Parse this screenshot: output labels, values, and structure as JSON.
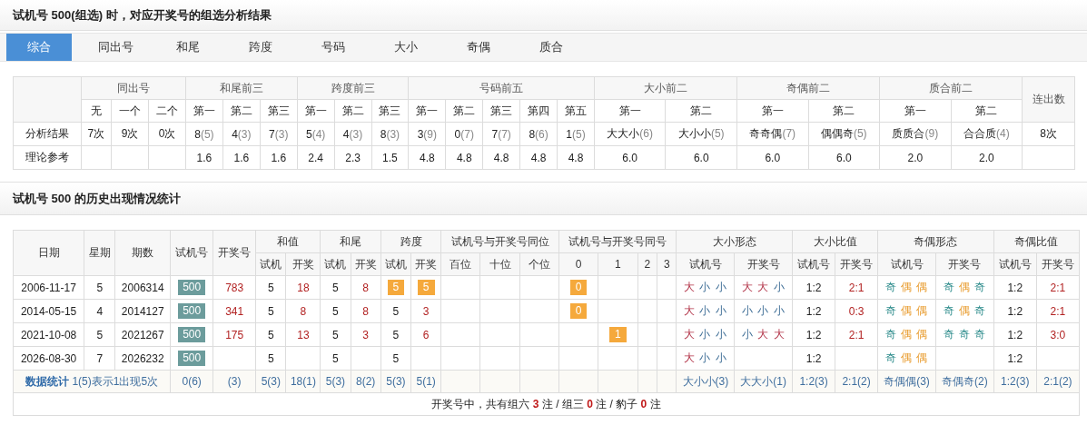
{
  "title": "试机号 500(组选) 时，对应开奖号的组选分析结果",
  "tabs": [
    {
      "label": "综合",
      "selected": true
    },
    {
      "label": "同出号",
      "selected": false
    },
    {
      "label": "和尾",
      "selected": false
    },
    {
      "label": "跨度",
      "selected": false
    },
    {
      "label": "号码",
      "selected": false
    },
    {
      "label": "大小",
      "selected": false
    },
    {
      "label": "奇偶",
      "selected": false
    },
    {
      "label": "质合",
      "selected": false
    }
  ],
  "analysis": {
    "groups": [
      {
        "label": "同出号",
        "sub": [
          "无",
          "一个",
          "二个"
        ]
      },
      {
        "label": "和尾前三",
        "sub": [
          "第一",
          "第二",
          "第三"
        ]
      },
      {
        "label": "跨度前三",
        "sub": [
          "第一",
          "第二",
          "第三"
        ]
      },
      {
        "label": "号码前五",
        "sub": [
          "第一",
          "第二",
          "第三",
          "第四",
          "第五"
        ]
      },
      {
        "label": "大小前二",
        "sub": [
          "第一",
          "第二"
        ]
      },
      {
        "label": "奇偶前二",
        "sub": [
          "第一",
          "第二"
        ]
      },
      {
        "label": "质合前二",
        "sub": [
          "第一",
          "第二"
        ]
      },
      {
        "label": "连出数"
      }
    ],
    "rows": [
      {
        "label": "分析结果",
        "cells": [
          {
            "text": "7次"
          },
          {
            "text": "9次"
          },
          {
            "text": "0次"
          },
          {
            "text": "8",
            "note": "(5)"
          },
          {
            "text": "4",
            "note": "(3)"
          },
          {
            "text": "7",
            "note": "(3)"
          },
          {
            "text": "5",
            "note": "(4)"
          },
          {
            "text": "4",
            "note": "(3)"
          },
          {
            "text": "8",
            "note": "(3)"
          },
          {
            "text": "3",
            "note": "(9)"
          },
          {
            "text": "0",
            "note": "(7)"
          },
          {
            "text": "7",
            "note": "(7)"
          },
          {
            "text": "8",
            "note": "(6)"
          },
          {
            "text": "1",
            "note": "(5)"
          },
          {
            "text": "大大小",
            "note": "(6)"
          },
          {
            "text": "大小小",
            "note": "(5)"
          },
          {
            "text": "奇奇偶",
            "note": "(7)"
          },
          {
            "text": "偶偶奇",
            "note": "(5)"
          },
          {
            "text": "质质合",
            "note": "(9)"
          },
          {
            "text": "合合质",
            "note": "(4)"
          },
          {
            "text": "8次"
          }
        ]
      },
      {
        "label": "理论参考",
        "cells": [
          null,
          null,
          null,
          {
            "text": "1.6"
          },
          {
            "text": "1.6"
          },
          {
            "text": "1.6"
          },
          {
            "text": "2.4"
          },
          {
            "text": "2.3"
          },
          {
            "text": "1.5"
          },
          {
            "text": "4.8"
          },
          {
            "text": "4.8"
          },
          {
            "text": "4.8"
          },
          {
            "text": "4.8"
          },
          {
            "text": "4.8"
          },
          {
            "text": "6.0"
          },
          {
            "text": "6.0"
          },
          {
            "text": "6.0"
          },
          {
            "text": "6.0"
          },
          {
            "text": "2.0"
          },
          {
            "text": "2.0"
          },
          null
        ]
      }
    ]
  },
  "history_title": "试机号 500 的历史出现情况统计",
  "history": {
    "groups": [
      {
        "label": "日期"
      },
      {
        "label": "星期"
      },
      {
        "label": "期数"
      },
      {
        "label": "试机号"
      },
      {
        "label": "开奖号"
      },
      {
        "label": "和值",
        "sub": [
          "试机",
          "开奖"
        ]
      },
      {
        "label": "和尾",
        "sub": [
          "试机",
          "开奖"
        ]
      },
      {
        "label": "跨度",
        "sub": [
          "试机",
          "开奖"
        ]
      },
      {
        "label": "试机号与开奖号同位",
        "sub": [
          "百位",
          "十位",
          "个位"
        ]
      },
      {
        "label": "试机号与开奖号同号",
        "sub": [
          "0",
          "1",
          "2",
          "3"
        ]
      },
      {
        "label": "大小形态",
        "sub": [
          "试机号",
          "开奖号"
        ]
      },
      {
        "label": "大小比值",
        "sub": [
          "试机号",
          "开奖号"
        ]
      },
      {
        "label": "奇偶形态",
        "sub": [
          "试机号",
          "开奖号"
        ]
      },
      {
        "label": "奇偶比值",
        "sub": [
          "试机号",
          "开奖号"
        ]
      }
    ],
    "rows": [
      {
        "cells": [
          {
            "kind": "plain",
            "text": "2006-11-17"
          },
          {
            "kind": "plain",
            "text": "5"
          },
          {
            "kind": "plain",
            "text": "2006314"
          },
          {
            "kind": "badge",
            "text": "500"
          },
          {
            "kind": "red",
            "text": "783"
          },
          {
            "kind": "plain",
            "text": "5"
          },
          {
            "kind": "red",
            "text": "18"
          },
          {
            "kind": "plain",
            "text": "5"
          },
          {
            "kind": "red",
            "text": "8"
          },
          {
            "kind": "mark",
            "text": "5"
          },
          {
            "kind": "mark",
            "text": "5"
          },
          null,
          null,
          null,
          {
            "kind": "mark",
            "text": "0"
          },
          null,
          null,
          null,
          {
            "kind": "pattern",
            "chars": [
              {
                "kind": "big",
                "text": "大"
              },
              {
                "kind": "small",
                "text": "小"
              },
              {
                "kind": "small",
                "text": "小"
              }
            ]
          },
          {
            "kind": "pattern",
            "chars": [
              {
                "kind": "big",
                "text": "大"
              },
              {
                "kind": "big",
                "text": "大"
              },
              {
                "kind": "small",
                "text": "小"
              }
            ]
          },
          {
            "kind": "plain",
            "text": "1:2"
          },
          {
            "kind": "red",
            "text": "2:1"
          },
          {
            "kind": "pattern",
            "chars": [
              {
                "kind": "odd",
                "text": "奇"
              },
              {
                "kind": "even",
                "text": "偶"
              },
              {
                "kind": "even",
                "text": "偶"
              }
            ]
          },
          {
            "kind": "pattern",
            "chars": [
              {
                "kind": "odd",
                "text": "奇"
              },
              {
                "kind": "even",
                "text": "偶"
              },
              {
                "kind": "odd",
                "text": "奇"
              }
            ]
          },
          {
            "kind": "plain",
            "text": "1:2"
          },
          {
            "kind": "red",
            "text": "2:1"
          }
        ]
      },
      {
        "cells": [
          {
            "kind": "plain",
            "text": "2014-05-15"
          },
          {
            "kind": "plain",
            "text": "4"
          },
          {
            "kind": "plain",
            "text": "2014127"
          },
          {
            "kind": "badge",
            "text": "500"
          },
          {
            "kind": "red",
            "text": "341"
          },
          {
            "kind": "plain",
            "text": "5"
          },
          {
            "kind": "red",
            "text": "8"
          },
          {
            "kind": "plain",
            "text": "5"
          },
          {
            "kind": "red",
            "text": "8"
          },
          {
            "kind": "plain",
            "text": "5"
          },
          {
            "kind": "red",
            "text": "3"
          },
          null,
          null,
          null,
          {
            "kind": "mark",
            "text": "0"
          },
          null,
          null,
          null,
          {
            "kind": "pattern",
            "chars": [
              {
                "kind": "big",
                "text": "大"
              },
              {
                "kind": "small",
                "text": "小"
              },
              {
                "kind": "small",
                "text": "小"
              }
            ]
          },
          {
            "kind": "pattern",
            "chars": [
              {
                "kind": "small",
                "text": "小"
              },
              {
                "kind": "small",
                "text": "小"
              },
              {
                "kind": "small",
                "text": "小"
              }
            ]
          },
          {
            "kind": "plain",
            "text": "1:2"
          },
          {
            "kind": "red",
            "text": "0:3"
          },
          {
            "kind": "pattern",
            "chars": [
              {
                "kind": "odd",
                "text": "奇"
              },
              {
                "kind": "even",
                "text": "偶"
              },
              {
                "kind": "even",
                "text": "偶"
              }
            ]
          },
          {
            "kind": "pattern",
            "chars": [
              {
                "kind": "odd",
                "text": "奇"
              },
              {
                "kind": "even",
                "text": "偶"
              },
              {
                "kind": "odd",
                "text": "奇"
              }
            ]
          },
          {
            "kind": "plain",
            "text": "1:2"
          },
          {
            "kind": "red",
            "text": "2:1"
          }
        ]
      },
      {
        "cells": [
          {
            "kind": "plain",
            "text": "2021-10-08"
          },
          {
            "kind": "plain",
            "text": "5"
          },
          {
            "kind": "plain",
            "text": "2021267"
          },
          {
            "kind": "badge",
            "text": "500"
          },
          {
            "kind": "red",
            "text": "175"
          },
          {
            "kind": "plain",
            "text": "5"
          },
          {
            "kind": "red",
            "text": "13"
          },
          {
            "kind": "plain",
            "text": "5"
          },
          {
            "kind": "red",
            "text": "3"
          },
          {
            "kind": "plain",
            "text": "5"
          },
          {
            "kind": "red",
            "text": "6"
          },
          null,
          null,
          null,
          null,
          {
            "kind": "mark",
            "text": "1"
          },
          null,
          null,
          {
            "kind": "pattern",
            "chars": [
              {
                "kind": "big",
                "text": "大"
              },
              {
                "kind": "small",
                "text": "小"
              },
              {
                "kind": "small",
                "text": "小"
              }
            ]
          },
          {
            "kind": "pattern",
            "chars": [
              {
                "kind": "small",
                "text": "小"
              },
              {
                "kind": "big",
                "text": "大"
              },
              {
                "kind": "big",
                "text": "大"
              }
            ]
          },
          {
            "kind": "plain",
            "text": "1:2"
          },
          {
            "kind": "red",
            "text": "2:1"
          },
          {
            "kind": "pattern",
            "chars": [
              {
                "kind": "odd",
                "text": "奇"
              },
              {
                "kind": "even",
                "text": "偶"
              },
              {
                "kind": "even",
                "text": "偶"
              }
            ]
          },
          {
            "kind": "pattern",
            "chars": [
              {
                "kind": "odd",
                "text": "奇"
              },
              {
                "kind": "odd",
                "text": "奇"
              },
              {
                "kind": "odd",
                "text": "奇"
              }
            ]
          },
          {
            "kind": "plain",
            "text": "1:2"
          },
          {
            "kind": "red",
            "text": "3:0"
          }
        ]
      },
      {
        "cells": [
          {
            "kind": "plain",
            "text": "2026-08-30"
          },
          {
            "kind": "plain",
            "text": "7"
          },
          {
            "kind": "plain",
            "text": "2026232"
          },
          {
            "kind": "badge",
            "text": "500"
          },
          null,
          {
            "kind": "plain",
            "text": "5"
          },
          null,
          {
            "kind": "plain",
            "text": "5"
          },
          null,
          {
            "kind": "plain",
            "text": "5"
          },
          null,
          null,
          null,
          null,
          null,
          null,
          null,
          null,
          {
            "kind": "pattern",
            "chars": [
              {
                "kind": "big",
                "text": "大"
              },
              {
                "kind": "small",
                "text": "小"
              },
              {
                "kind": "small",
                "text": "小"
              }
            ]
          },
          null,
          {
            "kind": "plain",
            "text": "1:2"
          },
          null,
          {
            "kind": "pattern",
            "chars": [
              {
                "kind": "odd",
                "text": "奇"
              },
              {
                "kind": "even",
                "text": "偶"
              },
              {
                "kind": "even",
                "text": "偶"
              }
            ]
          },
          null,
          {
            "kind": "plain",
            "text": "1:2"
          },
          null
        ]
      }
    ],
    "stats": {
      "title": "数据统计",
      "note": "1(5)表示1出现5次",
      "cells": [
        "0(6)",
        "(3)",
        "5(3)",
        "18(1)",
        "5(3)",
        "8(2)",
        "5(3)",
        "5(1)",
        null,
        null,
        null,
        null,
        null,
        null,
        null,
        "大小小(3)",
        "大大小(1)",
        "1:2(3)",
        "2:1(2)",
        "奇偶偶(3)",
        "奇偶奇(2)",
        "1:2(3)",
        "2:1(2)"
      ]
    },
    "summary": "开奖号中，共有组六 **3** 注 / 组三 **0** 注 / 豹子 **0** 注"
  }
}
